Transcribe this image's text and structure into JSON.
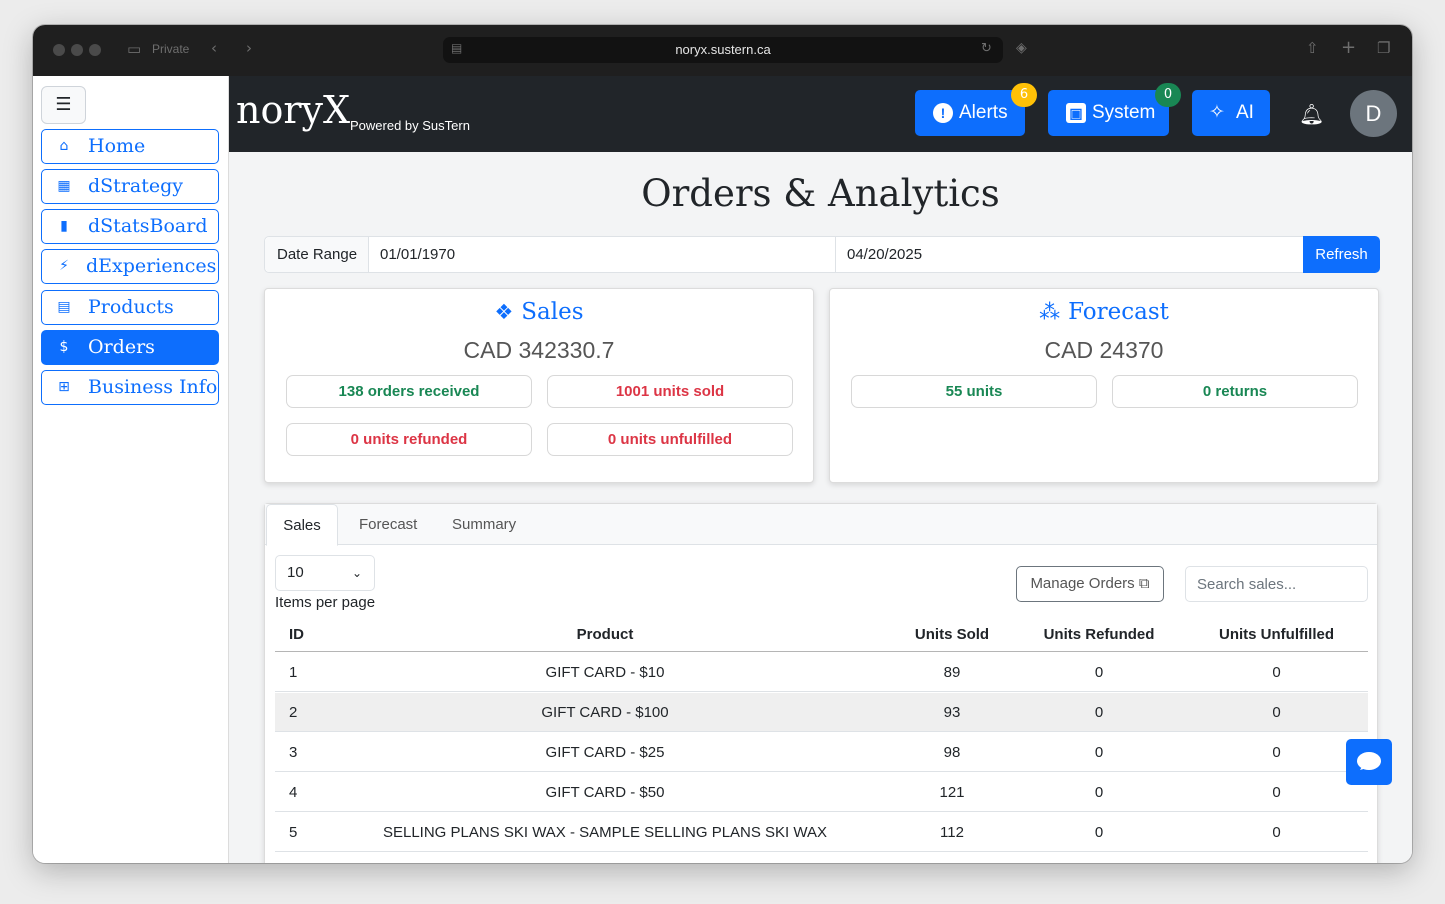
{
  "browser": {
    "private_label": "Private",
    "url": "noryx.sustern.ca"
  },
  "sidebar": {
    "menu_icon": "hamburger-icon",
    "items": [
      {
        "label": "Home",
        "icon": "home-icon",
        "active": false
      },
      {
        "label": "dStrategy",
        "icon": "grid-icon",
        "active": false
      },
      {
        "label": "dStatsBoard",
        "icon": "bar-chart-icon",
        "active": false
      },
      {
        "label": "dExperiences",
        "icon": "lightning-icon",
        "active": false
      },
      {
        "label": "Products",
        "icon": "document-icon",
        "active": false
      },
      {
        "label": "Orders",
        "icon": "receipt-icon",
        "active": true
      },
      {
        "label": "Business Info",
        "icon": "table-icon",
        "active": false
      }
    ]
  },
  "header": {
    "logo": "noryX",
    "powered_by": "Powered by SusTern",
    "alerts": {
      "label": "Alerts",
      "count": "6"
    },
    "system": {
      "label": "System",
      "count": "0"
    },
    "ai": {
      "label": "AI"
    },
    "avatar_initial": "D"
  },
  "page": {
    "title": "Orders & Analytics",
    "date_range": {
      "label": "Date Range",
      "from": "01/01/1970",
      "to": "04/20/2025",
      "refresh": "Refresh"
    }
  },
  "sales_card": {
    "title": "Sales",
    "amount": "CAD 342330.7",
    "stats": [
      "138 orders received",
      "1001 units sold",
      "0 units refunded",
      "0 units unfulfilled"
    ]
  },
  "forecast_card": {
    "title": "Forecast",
    "amount": "CAD 24370",
    "stats": [
      "55 units",
      "0 returns"
    ]
  },
  "tabs": [
    "Sales",
    "Forecast",
    "Summary"
  ],
  "table_controls": {
    "page_size": "10",
    "items_per_page": "Items per page",
    "manage_orders": "Manage Orders",
    "search_placeholder": "Search sales..."
  },
  "table": {
    "columns": [
      "ID",
      "Product",
      "Units Sold",
      "Units Refunded",
      "Units Unfulfilled"
    ],
    "rows": [
      {
        "id": "1",
        "product": "GIFT CARD - $10",
        "units_sold": "89",
        "units_refunded": "0",
        "units_unfulfilled": "0"
      },
      {
        "id": "2",
        "product": "GIFT CARD - $100",
        "units_sold": "93",
        "units_refunded": "0",
        "units_unfulfilled": "0"
      },
      {
        "id": "3",
        "product": "GIFT CARD - $25",
        "units_sold": "98",
        "units_refunded": "0",
        "units_unfulfilled": "0"
      },
      {
        "id": "4",
        "product": "GIFT CARD - $50",
        "units_sold": "121",
        "units_refunded": "0",
        "units_unfulfilled": "0"
      },
      {
        "id": "5",
        "product": "SELLING PLANS SKI WAX - SAMPLE SELLING PLANS SKI WAX",
        "units_sold": "112",
        "units_refunded": "0",
        "units_unfulfilled": "0"
      }
    ]
  },
  "colors": {
    "primary": "#0d6efd",
    "success": "#198754",
    "danger": "#dc3545",
    "header_bg": "#212529",
    "warning": "#ffc107"
  }
}
